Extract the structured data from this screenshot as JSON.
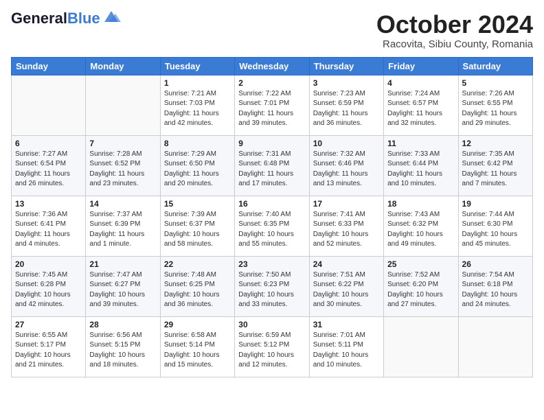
{
  "header": {
    "logo_general": "General",
    "logo_blue": "Blue",
    "month": "October 2024",
    "location": "Racovita, Sibiu County, Romania"
  },
  "days_of_week": [
    "Sunday",
    "Monday",
    "Tuesday",
    "Wednesday",
    "Thursday",
    "Friday",
    "Saturday"
  ],
  "weeks": [
    [
      {
        "num": "",
        "info": ""
      },
      {
        "num": "",
        "info": ""
      },
      {
        "num": "1",
        "info": "Sunrise: 7:21 AM\nSunset: 7:03 PM\nDaylight: 11 hours and 42 minutes."
      },
      {
        "num": "2",
        "info": "Sunrise: 7:22 AM\nSunset: 7:01 PM\nDaylight: 11 hours and 39 minutes."
      },
      {
        "num": "3",
        "info": "Sunrise: 7:23 AM\nSunset: 6:59 PM\nDaylight: 11 hours and 36 minutes."
      },
      {
        "num": "4",
        "info": "Sunrise: 7:24 AM\nSunset: 6:57 PM\nDaylight: 11 hours and 32 minutes."
      },
      {
        "num": "5",
        "info": "Sunrise: 7:26 AM\nSunset: 6:55 PM\nDaylight: 11 hours and 29 minutes."
      }
    ],
    [
      {
        "num": "6",
        "info": "Sunrise: 7:27 AM\nSunset: 6:54 PM\nDaylight: 11 hours and 26 minutes."
      },
      {
        "num": "7",
        "info": "Sunrise: 7:28 AM\nSunset: 6:52 PM\nDaylight: 11 hours and 23 minutes."
      },
      {
        "num": "8",
        "info": "Sunrise: 7:29 AM\nSunset: 6:50 PM\nDaylight: 11 hours and 20 minutes."
      },
      {
        "num": "9",
        "info": "Sunrise: 7:31 AM\nSunset: 6:48 PM\nDaylight: 11 hours and 17 minutes."
      },
      {
        "num": "10",
        "info": "Sunrise: 7:32 AM\nSunset: 6:46 PM\nDaylight: 11 hours and 13 minutes."
      },
      {
        "num": "11",
        "info": "Sunrise: 7:33 AM\nSunset: 6:44 PM\nDaylight: 11 hours and 10 minutes."
      },
      {
        "num": "12",
        "info": "Sunrise: 7:35 AM\nSunset: 6:42 PM\nDaylight: 11 hours and 7 minutes."
      }
    ],
    [
      {
        "num": "13",
        "info": "Sunrise: 7:36 AM\nSunset: 6:41 PM\nDaylight: 11 hours and 4 minutes."
      },
      {
        "num": "14",
        "info": "Sunrise: 7:37 AM\nSunset: 6:39 PM\nDaylight: 11 hours and 1 minute."
      },
      {
        "num": "15",
        "info": "Sunrise: 7:39 AM\nSunset: 6:37 PM\nDaylight: 10 hours and 58 minutes."
      },
      {
        "num": "16",
        "info": "Sunrise: 7:40 AM\nSunset: 6:35 PM\nDaylight: 10 hours and 55 minutes."
      },
      {
        "num": "17",
        "info": "Sunrise: 7:41 AM\nSunset: 6:33 PM\nDaylight: 10 hours and 52 minutes."
      },
      {
        "num": "18",
        "info": "Sunrise: 7:43 AM\nSunset: 6:32 PM\nDaylight: 10 hours and 49 minutes."
      },
      {
        "num": "19",
        "info": "Sunrise: 7:44 AM\nSunset: 6:30 PM\nDaylight: 10 hours and 45 minutes."
      }
    ],
    [
      {
        "num": "20",
        "info": "Sunrise: 7:45 AM\nSunset: 6:28 PM\nDaylight: 10 hours and 42 minutes."
      },
      {
        "num": "21",
        "info": "Sunrise: 7:47 AM\nSunset: 6:27 PM\nDaylight: 10 hours and 39 minutes."
      },
      {
        "num": "22",
        "info": "Sunrise: 7:48 AM\nSunset: 6:25 PM\nDaylight: 10 hours and 36 minutes."
      },
      {
        "num": "23",
        "info": "Sunrise: 7:50 AM\nSunset: 6:23 PM\nDaylight: 10 hours and 33 minutes."
      },
      {
        "num": "24",
        "info": "Sunrise: 7:51 AM\nSunset: 6:22 PM\nDaylight: 10 hours and 30 minutes."
      },
      {
        "num": "25",
        "info": "Sunrise: 7:52 AM\nSunset: 6:20 PM\nDaylight: 10 hours and 27 minutes."
      },
      {
        "num": "26",
        "info": "Sunrise: 7:54 AM\nSunset: 6:18 PM\nDaylight: 10 hours and 24 minutes."
      }
    ],
    [
      {
        "num": "27",
        "info": "Sunrise: 6:55 AM\nSunset: 5:17 PM\nDaylight: 10 hours and 21 minutes."
      },
      {
        "num": "28",
        "info": "Sunrise: 6:56 AM\nSunset: 5:15 PM\nDaylight: 10 hours and 18 minutes."
      },
      {
        "num": "29",
        "info": "Sunrise: 6:58 AM\nSunset: 5:14 PM\nDaylight: 10 hours and 15 minutes."
      },
      {
        "num": "30",
        "info": "Sunrise: 6:59 AM\nSunset: 5:12 PM\nDaylight: 10 hours and 12 minutes."
      },
      {
        "num": "31",
        "info": "Sunrise: 7:01 AM\nSunset: 5:11 PM\nDaylight: 10 hours and 10 minutes."
      },
      {
        "num": "",
        "info": ""
      },
      {
        "num": "",
        "info": ""
      }
    ]
  ]
}
